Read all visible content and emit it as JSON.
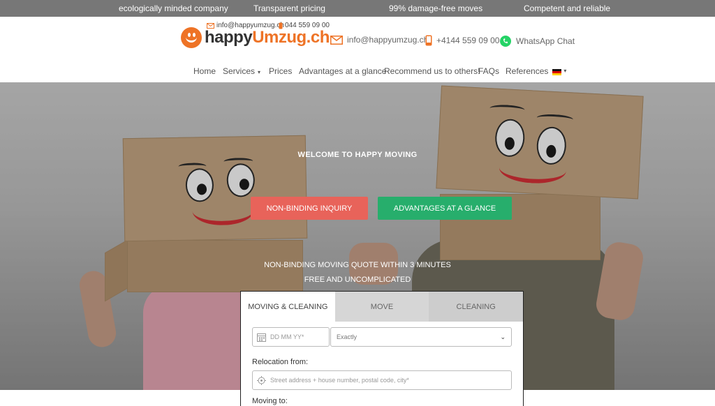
{
  "topbar": {
    "items": [
      "ecologically minded company",
      "Transparent pricing",
      "99% damage-free moves",
      "Competent and reliable"
    ]
  },
  "header": {
    "mini_email": "info@happyumzug.ch",
    "mini_phone": "044 559 09 00",
    "logo_happy": "happy",
    "logo_umzug": "Umzug.ch",
    "email": "info@happyumzug.ch",
    "phone": "+4144 559 09 00",
    "whatsapp": "WhatsApp Chat"
  },
  "nav": {
    "items": [
      "Home",
      "Services",
      "Prices",
      "Advantages at a glance",
      "Recommend us to others!",
      "FAQs",
      "References"
    ]
  },
  "hero": {
    "welcome": "WELCOME TO HAPPY MOVING",
    "btn_inquiry": "NON-BINDING INQUIRY",
    "btn_advantages": "ADVANTAGES AT A GLANCE",
    "quote_line1": "NON-BINDING MOVING QUOTE WITHIN 3 MINUTES",
    "quote_line2": "FREE AND UNCOMPLICATED"
  },
  "form": {
    "tabs": [
      "MOVING & CLEANING",
      "MOVE",
      "CLEANING"
    ],
    "date_placeholder": "DD MM YY*",
    "date_mode": "Exactly",
    "from_label": "Relocation from:",
    "from_placeholder": "Street address + house number, postal code, city*",
    "to_label": "Moving to:"
  },
  "colors": {
    "brand_orange": "#ee7326",
    "inquiry_red": "#e8635a",
    "advantage_green": "#27ae6c",
    "topbar_gray": "#777777"
  }
}
